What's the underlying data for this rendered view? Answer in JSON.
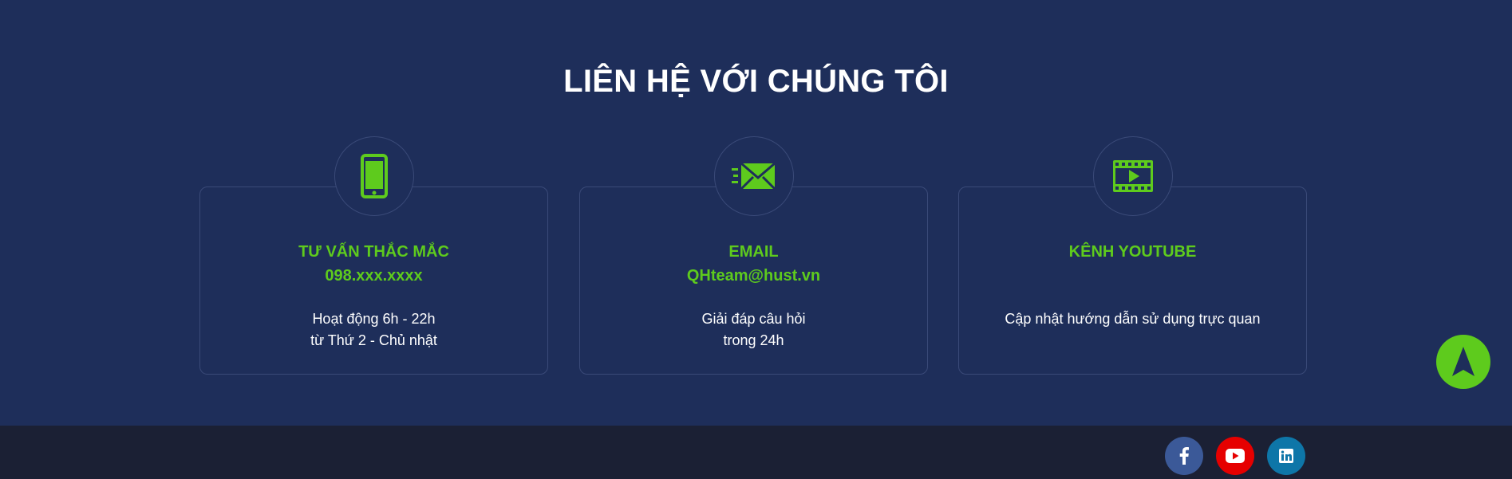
{
  "section": {
    "title": "LIÊN HỆ VỚI CHÚNG TÔI"
  },
  "cards": [
    {
      "icon": "smartphone-icon",
      "title": "TƯ VẤN THẮC MẮC",
      "subtitle": "098.xxx.xxxx",
      "desc_lines": [
        "Hoạt động 6h - 22h",
        "từ Thứ 2 - Chủ nhật"
      ]
    },
    {
      "icon": "email-icon",
      "title": "EMAIL",
      "subtitle": "QHteam@hust.vn",
      "desc_lines": [
        "Giải đáp câu hỏi",
        "trong 24h"
      ]
    },
    {
      "icon": "video-icon",
      "title": "KÊNH YOUTUBE",
      "desc_lines": [
        "Cập nhật hướng dẫn sử dụng trực quan"
      ]
    }
  ],
  "footer": {
    "social": [
      {
        "icon": "facebook-icon",
        "color": "#3b5998"
      },
      {
        "icon": "youtube-icon",
        "color": "#e60000"
      },
      {
        "icon": "linkedin-icon",
        "color": "#0e76a8"
      }
    ]
  },
  "colors": {
    "background": "#1e2e5a",
    "accent": "#5ecb1d",
    "footer": "#1b2034",
    "border": "#3a4a78"
  }
}
